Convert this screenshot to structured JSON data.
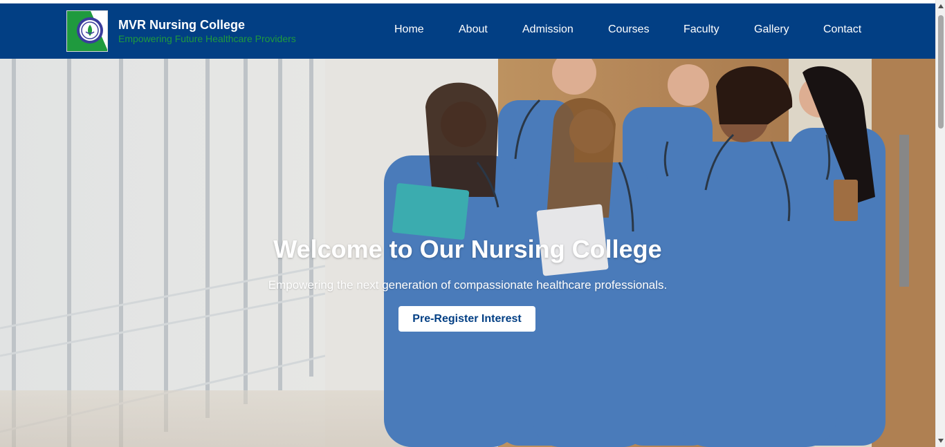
{
  "header": {
    "title": "MVR Nursing College",
    "tagline": "Empowering Future Healthcare Providers",
    "logo_icon": "college-crest-icon"
  },
  "nav": {
    "items": [
      {
        "label": "Home"
      },
      {
        "label": "About"
      },
      {
        "label": "Admission"
      },
      {
        "label": "Courses"
      },
      {
        "label": "Faculty"
      },
      {
        "label": "Gallery"
      },
      {
        "label": "Contact"
      }
    ]
  },
  "hero": {
    "title": "Welcome to Our Nursing College",
    "subtitle": "Empowering the next generation of compassionate healthcare professionals.",
    "cta_label": "Pre-Register Interest"
  },
  "colors": {
    "header_bg": "#023f84",
    "tagline": "#1f9a3e",
    "cta_text": "#023f84",
    "scrubs": "#4f82c4"
  }
}
